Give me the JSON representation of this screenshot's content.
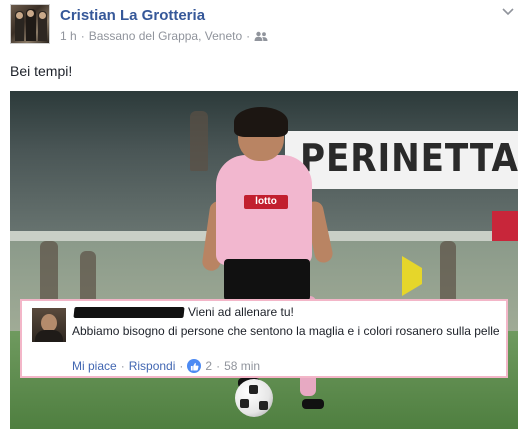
{
  "post": {
    "author": "Cristian La Grotteria",
    "time": "1 h",
    "location": "Bassano del Grappa, Veneto",
    "separator": "·",
    "text": "Bei tempi!"
  },
  "photo": {
    "banner_text": "PERINETTA",
    "shirt_brand": "lotto"
  },
  "comment": {
    "text_line1": "Vieni ad allenare tu!",
    "text_line2": "Abbiamo bisogno di persone che sentono la maglia e i colori rosanero sulla pelle",
    "like_label": "Mi piace",
    "reply_label": "Rispondi",
    "separator": "·",
    "like_count": "2",
    "time": "58 min"
  },
  "icons": {
    "clock": "clock-icon",
    "audience": "friends-audience-icon",
    "menu": "chevron-down-icon",
    "like": "thumbs-up-icon"
  },
  "colors": {
    "link_blue": "#365899",
    "meta_gray": "#90949c",
    "comment_border": "#f3b6c8",
    "like_badge": "#4c8af3"
  }
}
